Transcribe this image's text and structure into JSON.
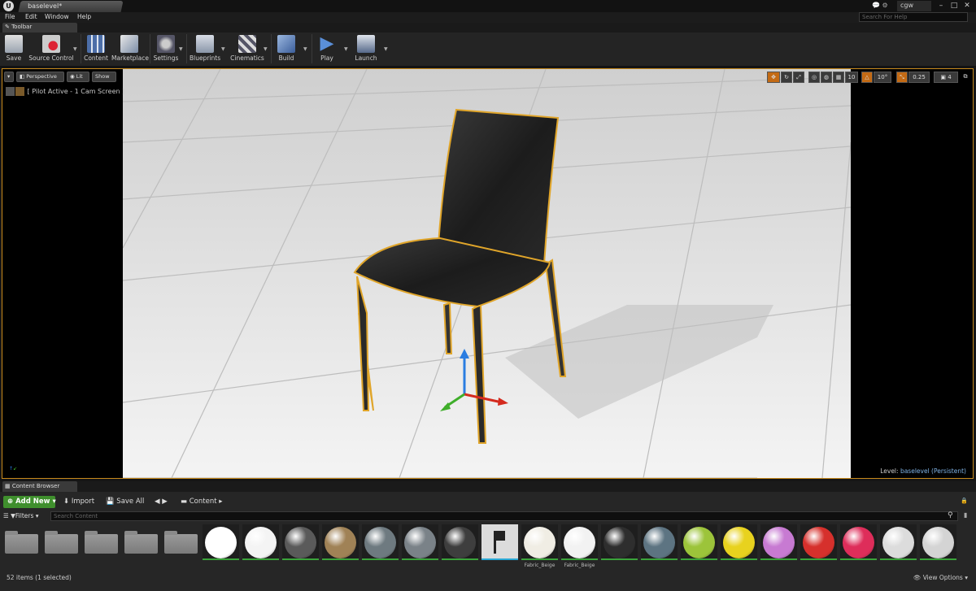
{
  "window": {
    "tab_title": "baselevel*",
    "user": "cgw",
    "search_help_placeholder": "Search For Help",
    "min": "–",
    "max": "□",
    "close": "✕"
  },
  "menu": [
    "File",
    "Edit",
    "Window",
    "Help"
  ],
  "toolbar": {
    "tab_label": "Toolbar",
    "buttons": [
      "Save",
      "Source Control",
      "Content",
      "Marketplace",
      "Settings",
      "Blueprints",
      "Cinematics",
      "Build",
      "Play",
      "Launch"
    ]
  },
  "viewport": {
    "perspective": "Perspective",
    "lit": "Lit",
    "show": "Show",
    "pilot": "[ Pilot Active - 1 Cam Screen ]",
    "grid_snap": "10",
    "rotation_snap": "10°",
    "scale_snap": "0.25",
    "camera_speed": "4",
    "level_label": "Level:",
    "level_name": "baselevel (Persistent)"
  },
  "content_browser": {
    "tab_label": "Content Browser",
    "add_new": "Add New",
    "import": "Import",
    "save_all": "Save All",
    "path": "Content",
    "filters": "Filters",
    "search_placeholder": "Search Content",
    "status": "52 items (1 selected)",
    "view_options": "View Options",
    "assets": [
      {
        "kind": "folder",
        "name": ""
      },
      {
        "kind": "folder",
        "name": ""
      },
      {
        "kind": "folder",
        "name": ""
      },
      {
        "kind": "folder",
        "name": ""
      },
      {
        "kind": "folder",
        "name": ""
      },
      {
        "kind": "material",
        "name": "",
        "color": "#ffffff",
        "bar": "#3aa33a"
      },
      {
        "kind": "material",
        "name": "",
        "color": "#f4f4f4",
        "bar": "#3aa33a"
      },
      {
        "kind": "material",
        "name": "",
        "color": "#5a5a5a",
        "bar": "#3aa33a"
      },
      {
        "kind": "material",
        "name": "",
        "color": "#a08256",
        "bar": "#3aa33a"
      },
      {
        "kind": "material",
        "name": "",
        "color": "#6e7a80",
        "bar": "#3aa33a"
      },
      {
        "kind": "material",
        "name": "",
        "color": "#7a8288",
        "bar": "#3aa33a"
      },
      {
        "kind": "material",
        "name": "",
        "color": "#3e3e3e",
        "bar": "#3aa33a"
      },
      {
        "kind": "mesh",
        "name": "",
        "color": "#dcdcdc",
        "bar": "#2aa9d6"
      },
      {
        "kind": "material",
        "name": "Fabric_Beige",
        "color": "#f0ede4",
        "bar": "#3aa33a"
      },
      {
        "kind": "material",
        "name": "Fabric_Beige",
        "color": "#f2f2f2",
        "bar": "#3aa33a"
      },
      {
        "kind": "material",
        "name": "",
        "color": "#2e2e2e",
        "bar": "#3aa33a"
      },
      {
        "kind": "material",
        "name": "",
        "color": "#5d7482",
        "bar": "#3aa33a"
      },
      {
        "kind": "material",
        "name": "",
        "color": "#9cc43a",
        "bar": "#3aa33a"
      },
      {
        "kind": "material",
        "name": "",
        "color": "#e8d21e",
        "bar": "#3aa33a"
      },
      {
        "kind": "material",
        "name": "",
        "color": "#c77ad2",
        "bar": "#3aa33a"
      },
      {
        "kind": "material",
        "name": "",
        "color": "#d6302c",
        "bar": "#3aa33a"
      },
      {
        "kind": "material",
        "name": "",
        "color": "#de2d5a",
        "bar": "#3aa33a"
      },
      {
        "kind": "material",
        "name": "",
        "color": "#dcdcdc",
        "bar": "#3aa33a"
      },
      {
        "kind": "material",
        "name": "",
        "color": "#d4d4d4",
        "bar": "#3aa33a"
      }
    ]
  }
}
